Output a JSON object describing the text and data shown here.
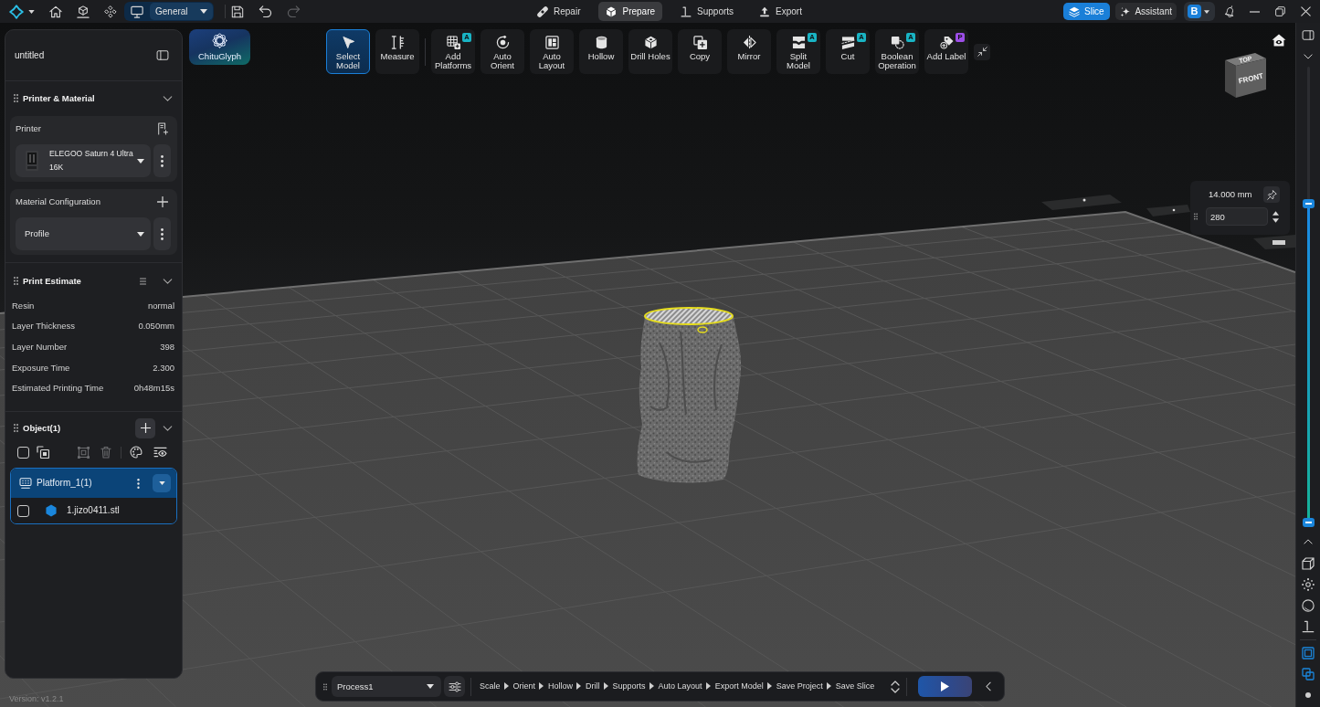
{
  "title_bar": {
    "workspace": {
      "value": "General"
    },
    "history": [
      {
        "kind": "undo",
        "disabled": false
      },
      {
        "kind": "redo",
        "disabled": true
      }
    ],
    "tabs": [
      {
        "label": "Repair",
        "selected": false
      },
      {
        "label": "Prepare",
        "selected": true
      },
      {
        "label": "Supports",
        "selected": false
      },
      {
        "label": "Export",
        "selected": false
      }
    ],
    "slice_button": {
      "label": "Slice"
    },
    "assistant_button": {
      "label": "Assistant"
    },
    "account": {
      "initial": "B"
    }
  },
  "sidebar": {
    "project_name": "untitled",
    "printer_material": {
      "title": "Printer & Material",
      "printer": {
        "label": "Printer",
        "value": "ELEGOO Saturn 4 Ultra 16K"
      },
      "material": {
        "label": "Material Configuration",
        "value": "Profile"
      }
    },
    "print_estimate": {
      "title": "Print Estimate",
      "rows": [
        {
          "label": "Resin",
          "value": "normal"
        },
        {
          "label": "Layer Thickness",
          "value": "0.050mm"
        },
        {
          "label": "Layer Number",
          "value": "398"
        },
        {
          "label": "Exposure Time",
          "value": "2.300"
        },
        {
          "label": "Estimated Printing Time",
          "value": "0h48m15s"
        }
      ]
    },
    "objects": {
      "title": "Object(1)",
      "select_all": {
        "checked": false
      },
      "tools": [
        {
          "disabled": false
        },
        {
          "disabled": true
        },
        {
          "disabled": true
        },
        {
          "disabled": false
        },
        {
          "disabled": false
        }
      ],
      "platforms": [
        {
          "name": "Platform_1(1)",
          "selected": true,
          "expanded": true,
          "children": [
            {
              "name": "1.jizo0411.stl",
              "checked": false,
              "selected": false
            }
          ]
        }
      ]
    }
  },
  "chitu_glyph_button": {
    "label": "ChituGlyph"
  },
  "toolbar": {
    "groups": [
      [
        {
          "label": "Select Model",
          "selected": true
        },
        {
          "label": "Measure",
          "selected": false
        }
      ],
      [
        {
          "label": "Add Platforms",
          "selected": false,
          "badge": {
            "text": "A",
            "color": "#19b4c4"
          }
        },
        {
          "label": "Auto Orient",
          "selected": false
        },
        {
          "label": "Auto Layout",
          "selected": false
        },
        {
          "label": "Hollow",
          "selected": false
        },
        {
          "label": "Drill Holes",
          "selected": false
        },
        {
          "label": "Copy",
          "selected": false
        },
        {
          "label": "Mirror",
          "selected": false
        },
        {
          "label": "Split Model",
          "selected": false,
          "badge": {
            "text": "A",
            "color": "#19b4c4"
          }
        },
        {
          "label": "Cut",
          "selected": false,
          "badge": {
            "text": "A",
            "color": "#19b4c4"
          }
        },
        {
          "label": "Boolean Operation",
          "selected": false,
          "badge": {
            "text": "A",
            "color": "#19b4c4"
          }
        },
        {
          "label": "Add Label",
          "selected": false,
          "badge": {
            "text": "P",
            "color": "#9d4ee8"
          }
        }
      ]
    ]
  },
  "view_cube": {
    "faces": [
      "TOP",
      "FRONT"
    ]
  },
  "layer_panel": {
    "height": "14.000 mm",
    "layer": "280"
  },
  "layer_slider": {
    "level": 0.7
  },
  "view_toggles": [
    {
      "on": true
    },
    {
      "on": true
    }
  ],
  "process_bar": {
    "process": "Process1",
    "steps": [
      "Scale",
      "Orient",
      "Hollow",
      "Drill",
      "Supports",
      "Auto Layout",
      "Export Model",
      "Save Project",
      "Save Slice"
    ]
  },
  "version": "Version: v1.2.1"
}
